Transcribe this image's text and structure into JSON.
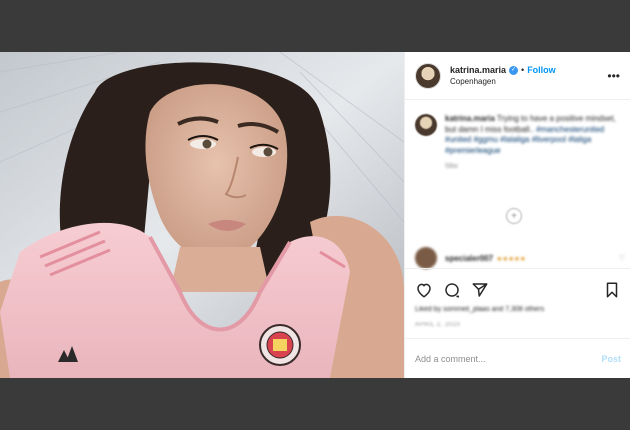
{
  "post": {
    "username": "katrina.maria",
    "verified_icon": "verified-badge-icon",
    "separator": "•",
    "follow_label": "Follow",
    "location": "Copenhagen",
    "more_label": "•••"
  },
  "caption": {
    "username": "katrina.maria",
    "text": "Trying to have a positive mindset, but damn I miss football..",
    "hashtags": "#manchesterunited #united #ggmu #lalaliga #liverpool #laliga #premierleague",
    "time": "58w"
  },
  "comment": {
    "username": "specialer007",
    "emojis": "●●●●●",
    "like_label": "♡"
  },
  "actions": {
    "like_icon": "heart-icon",
    "comment_icon": "comment-icon",
    "share_icon": "share-icon",
    "save_icon": "bookmark-icon"
  },
  "likes_text": "Liked by sommeil_plaas and 7,308 others",
  "date_text": "APRIL 2, 2020",
  "add_comment": {
    "placeholder": "Add a comment...",
    "post_label": "Post"
  },
  "colors": {
    "background": "#3a3a3a",
    "link": "#0095f6",
    "post_disabled": "#b2dffc",
    "jersey": "#f4c6cc"
  }
}
